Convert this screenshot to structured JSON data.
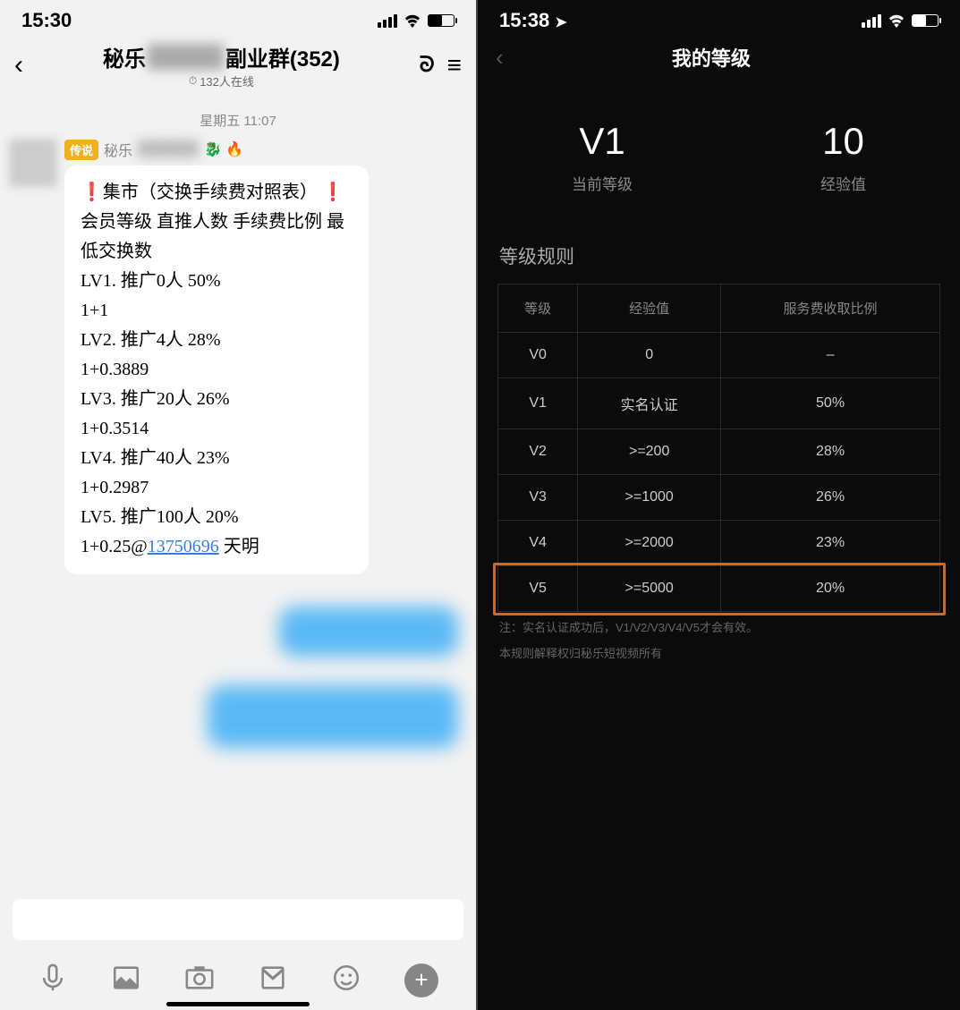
{
  "left": {
    "status_time": "15:30",
    "title_prefix": "秘乐",
    "title_hidden": "█████",
    "title_suffix": "副业群(352)",
    "online_text": "132人在线",
    "date_separator": "星期五 11:07",
    "sender_badge": "传说",
    "sender_prefix": "秘乐",
    "sender_hidden": "██████",
    "sender_emoji": "🐉 🔥",
    "bubble_lines": [
      "❗集市（交换手续费对照表）❗",
      "会员等级  直推人数  手续费比例  最低交换数",
      "",
      "LV1.      推广0人    50%",
      "          1+1",
      "LV2.      推广4人    28%",
      "          1+0.3889",
      "LV3.      推广20人   26%",
      "          1+0.3514",
      "LV4.      推广40人   23%",
      "          1+0.2987",
      "LV5.      推广100人  20%",
      "          1+0.25@"
    ],
    "bubble_link": "13750696",
    "bubble_tail": " 天明"
  },
  "right": {
    "status_time": "15:38",
    "page_title": "我的等级",
    "level_value": "V1",
    "level_label": "当前等级",
    "exp_value": "10",
    "exp_label": "经验值",
    "section_title": "等级规则",
    "th1": "等级",
    "th2": "经验值",
    "th3": "服务费收取比例",
    "rows": [
      {
        "lvl": "V0",
        "exp": "0",
        "fee": "–"
      },
      {
        "lvl": "V1",
        "exp": "实名认证",
        "fee": "50%"
      },
      {
        "lvl": "V2",
        "exp": ">=200",
        "fee": "28%"
      },
      {
        "lvl": "V3",
        "exp": ">=1000",
        "fee": "26%"
      },
      {
        "lvl": "V4",
        "exp": ">=2000",
        "fee": "23%"
      },
      {
        "lvl": "V5",
        "exp": ">=5000",
        "fee": "20%"
      }
    ],
    "note1": "注：实名认证成功后，V1/V2/V3/V4/V5才会有效。",
    "note2": "本规则解释权归秘乐短视频所有"
  }
}
